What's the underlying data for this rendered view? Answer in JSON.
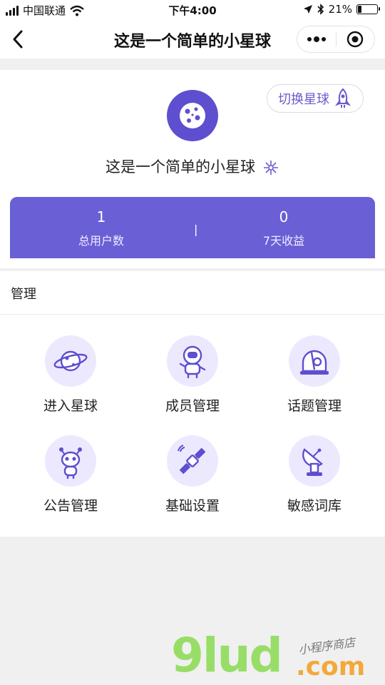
{
  "status_bar": {
    "carrier": "中国联通",
    "time": "下午4:00",
    "battery": "21%",
    "battery_level": 0.21
  },
  "nav": {
    "title": "这是一个简单的小星球",
    "back_icon": "chevron-left-icon",
    "more_icon": "more-dots-icon",
    "close_icon": "target-circle-icon"
  },
  "header": {
    "switch_label": "切换星球",
    "switch_icon": "rocket-icon",
    "logo_icon": "cookie-planet-icon",
    "planet_name": "这是一个简单的小星球",
    "name_icon": "sparkle-icon"
  },
  "stats": {
    "users_value": "1",
    "users_label": "总用户数",
    "divider": "|",
    "income_value": "0",
    "income_label": "7天收益"
  },
  "manage": {
    "title": "管理",
    "items": [
      {
        "label": "进入星球",
        "icon": "planet-ring-icon"
      },
      {
        "label": "成员管理",
        "icon": "astronaut-icon"
      },
      {
        "label": "话题管理",
        "icon": "observatory-icon"
      },
      {
        "label": "公告管理",
        "icon": "alien-icon"
      },
      {
        "label": "基础设置",
        "icon": "satellite-icon"
      },
      {
        "label": "敏感词库",
        "icon": "radar-dish-icon"
      }
    ]
  },
  "watermark": {
    "main": "9lud",
    "domain": ".com",
    "sub": "小程序商店"
  },
  "colors": {
    "accent": "#6b5fd6",
    "icon_bg": "#ece9ff",
    "page_bg": "#f0f0f0"
  }
}
